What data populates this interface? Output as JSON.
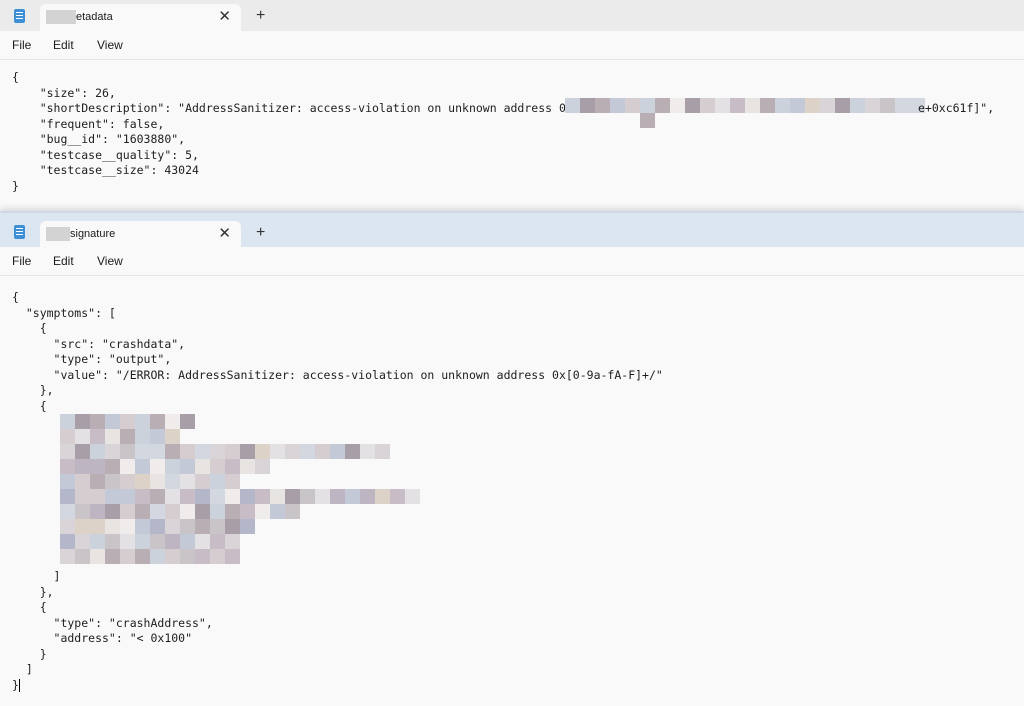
{
  "window1": {
    "tab_title": "etadata",
    "close_glyph": "✕",
    "new_tab_glyph": "+",
    "menu": [
      "File",
      "Edit",
      "View"
    ],
    "lines": [
      "{",
      "    \"size\": 26,",
      "    \"shortDescription\": \"AddressSanitizer: access-violation on unknown address 0x6",
      "    \"frequent\": false,",
      "    \"bug__id\": \"1603880\",",
      "    \"testcase__quality\": 5,",
      "    \"testcase__size\": 43024",
      "}"
    ],
    "line3_tail": "e+0xc61f]\","
  },
  "window2": {
    "tab_title": "signature",
    "close_glyph": "✕",
    "new_tab_glyph": "+",
    "menu": [
      "File",
      "Edit",
      "View"
    ],
    "lines": [
      "{",
      "  \"symptoms\": [",
      "    {",
      "      \"src\": \"crashdata\",",
      "      \"type\": \"output\",",
      "      \"value\": \"/ERROR: AddressSanitizer: access-violation on unknown address 0x[0-9a-fA-F]+/\"",
      "    },",
      "    {",
      "",
      "",
      "",
      "",
      "",
      "",
      "",
      "",
      "",
      "",
      "      ]",
      "    },",
      "    {",
      "      \"type\": \"crashAddress\",",
      "      \"address\": \"< 0x100\"",
      "    }",
      "  ]",
      "}"
    ]
  }
}
